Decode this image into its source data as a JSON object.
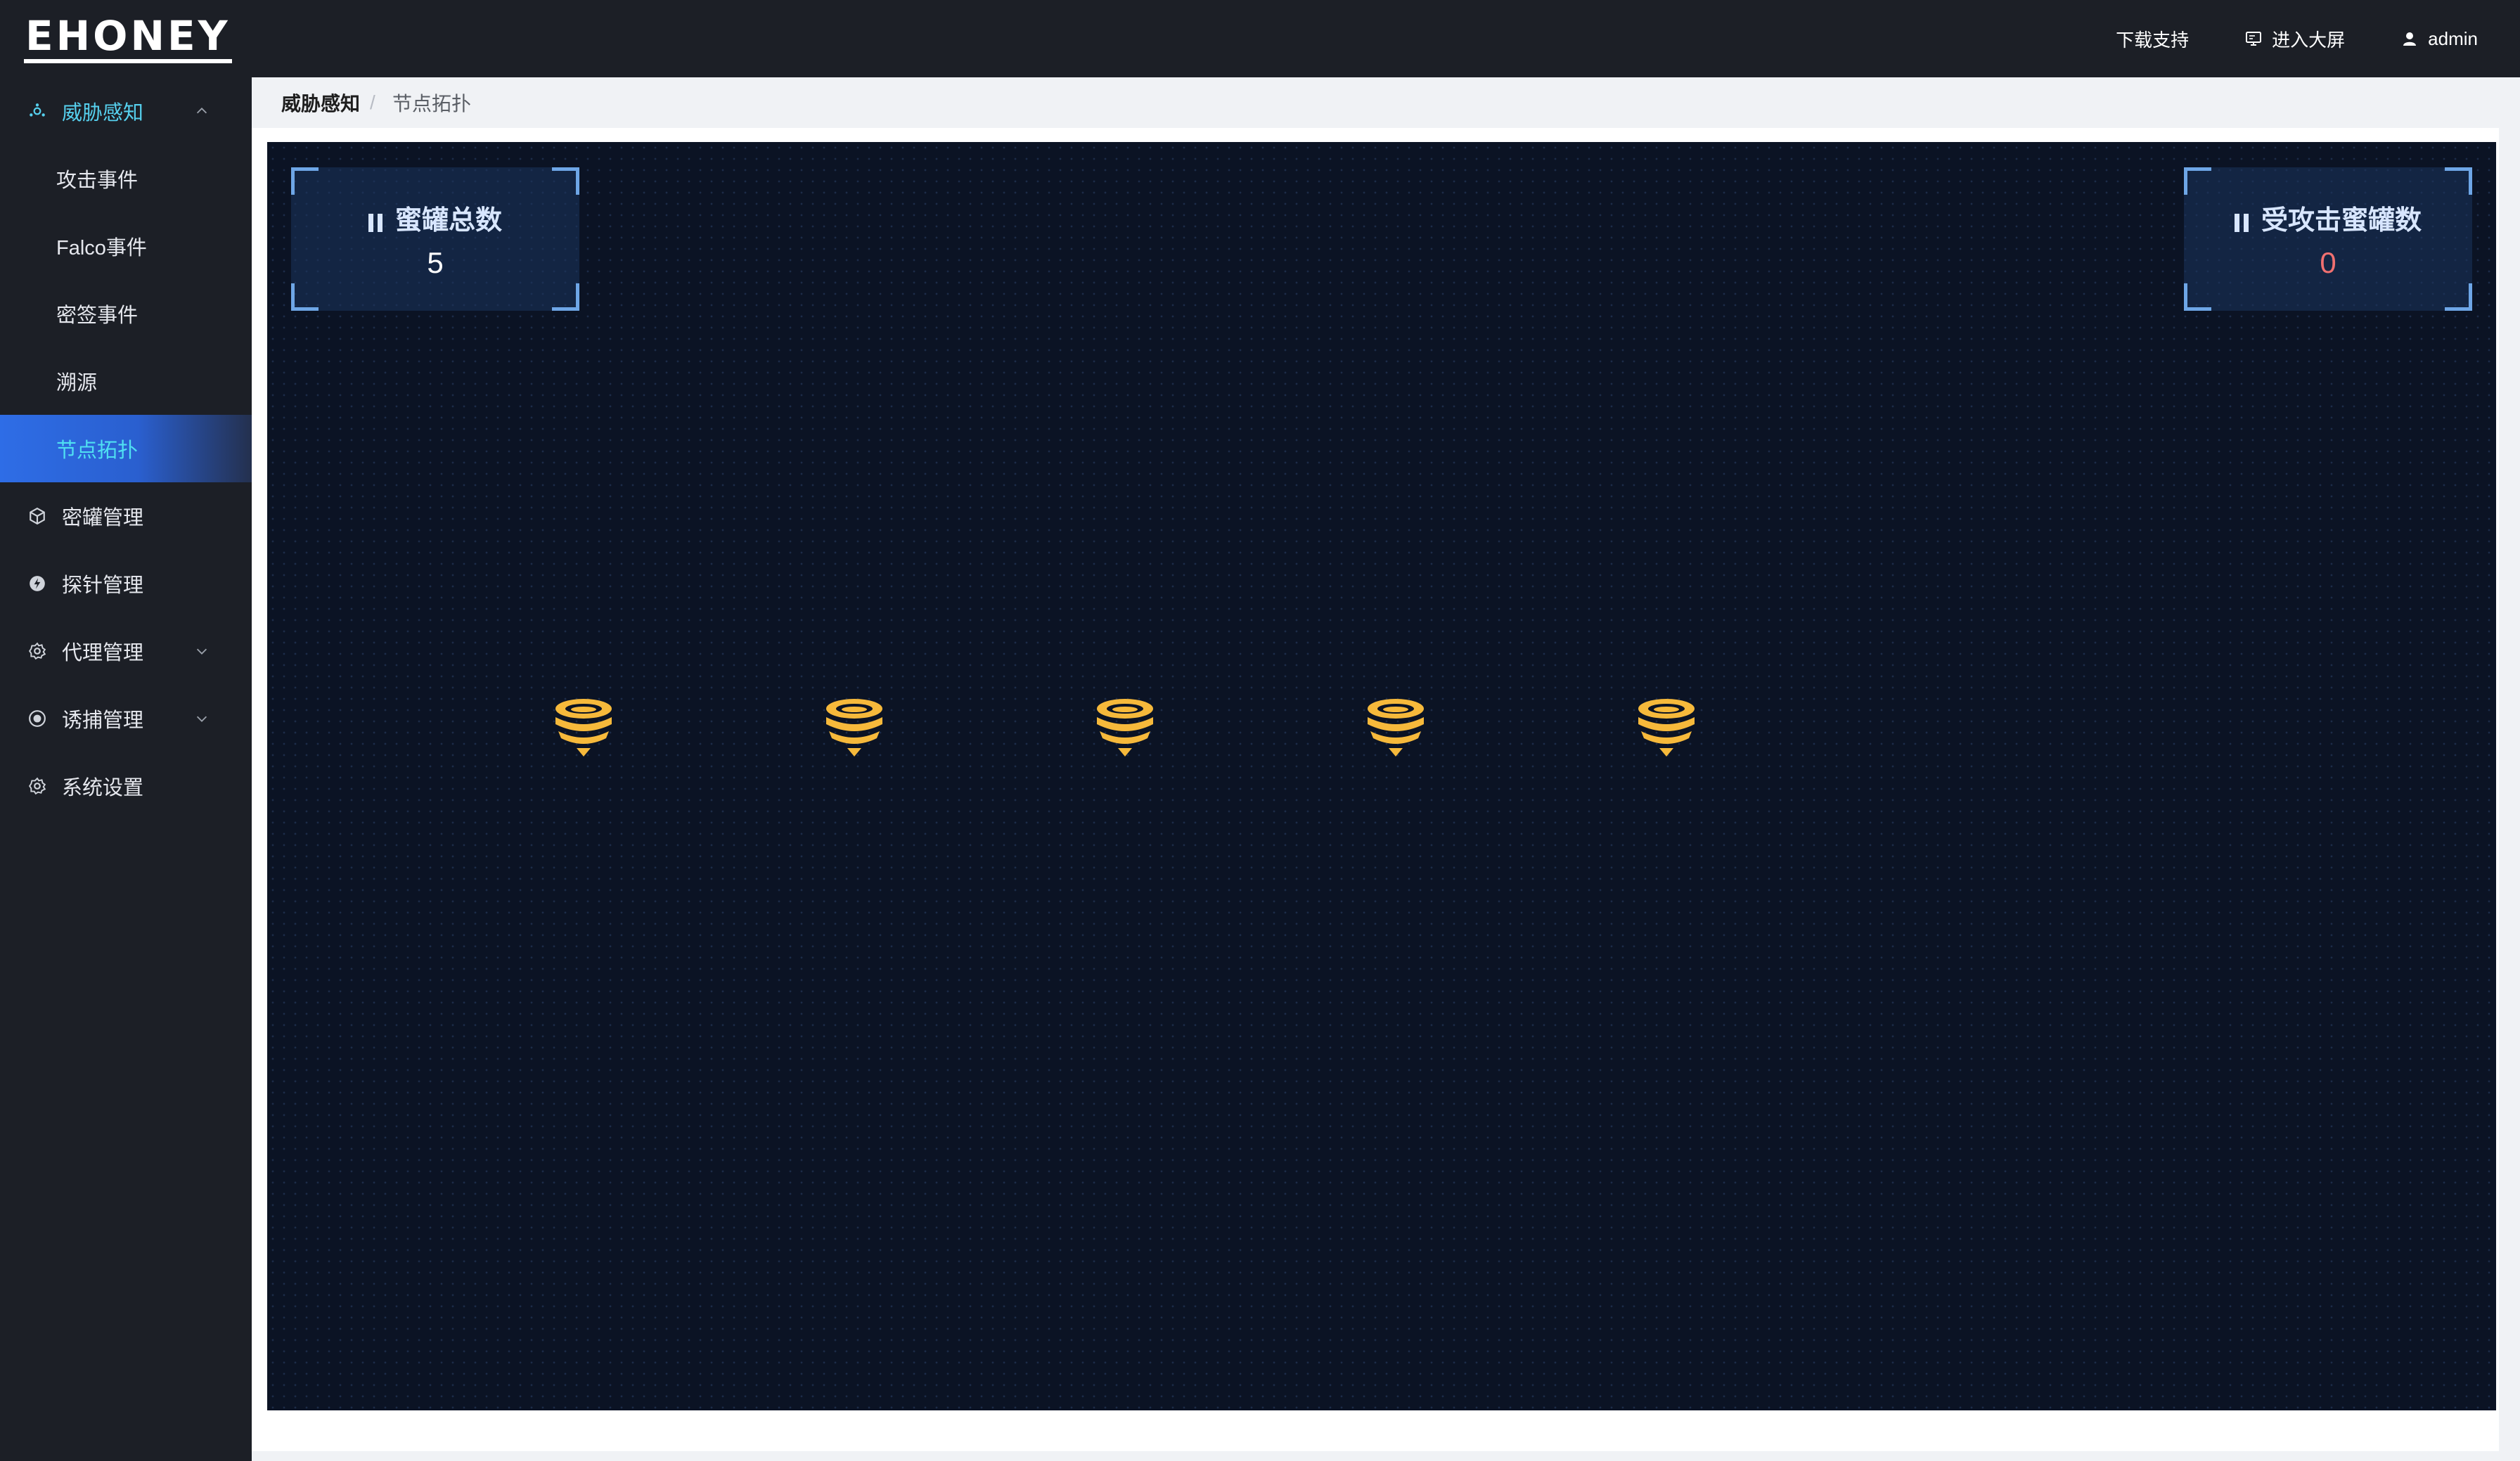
{
  "header": {
    "logo": "EHONEY",
    "download_support": "下载支持",
    "big_screen": "进入大屏",
    "user": "admin"
  },
  "sidebar": {
    "items": [
      {
        "label": "威胁感知",
        "icon": "threat-awareness-icon",
        "expanded": true
      },
      {
        "label": "攻击事件"
      },
      {
        "label": "Falco事件"
      },
      {
        "label": "密签事件"
      },
      {
        "label": "溯源"
      },
      {
        "label": "节点拓扑",
        "active": true
      },
      {
        "label": "密罐管理",
        "icon": "cube-icon"
      },
      {
        "label": "探针管理",
        "icon": "probe-icon"
      },
      {
        "label": "代理管理",
        "icon": "gear-icon",
        "expandable": true
      },
      {
        "label": "诱捕管理",
        "icon": "trap-icon",
        "expandable": true
      },
      {
        "label": "系统设置",
        "icon": "settings-icon"
      }
    ]
  },
  "breadcrumb": {
    "parent": "威胁感知",
    "separator": "/",
    "current": "节点拓扑"
  },
  "stats": {
    "total_honeypots": {
      "label": "蜜罐总数",
      "value": "5",
      "color": "#ffffff"
    },
    "attacked_honeypots": {
      "label": "受攻击蜜罐数",
      "value": "0",
      "color": "#f07070"
    }
  },
  "topology": {
    "node_count": 5,
    "node_icon": "honeypot-node-icon",
    "node_color": "#f6b93b"
  },
  "colors": {
    "accent": "#56d0ee",
    "active_menu": "#2e6de6",
    "canvas_bg": "#0b1324",
    "sidebar_bg": "#1c1f26"
  }
}
